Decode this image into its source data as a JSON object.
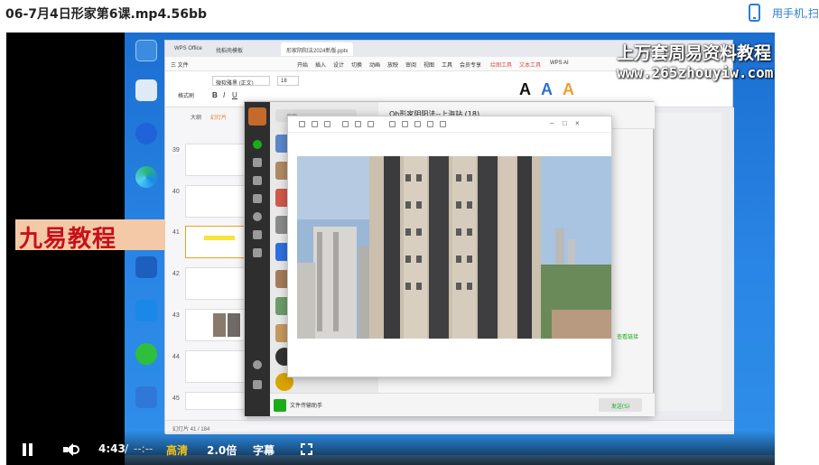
{
  "page": {
    "title": "06-7月4日形家第6课.mp4.56bb",
    "phone_link": "用手机,扫"
  },
  "wps": {
    "tabs": [
      "WPS Office",
      "找稻壳模板",
      "形家阴阳法2024新版.pptx"
    ],
    "menus": [
      "三 文件",
      "开始",
      "插入",
      "设计",
      "切换",
      "动画",
      "放映",
      "审阅",
      "视图",
      "工具",
      "会员专享",
      "绘图工具",
      "文本工具",
      "WPS AI"
    ],
    "font_name": "微软雅黑 (正文)",
    "font_size": "18",
    "format_label": "格式刷",
    "panel_tabs": [
      "大纲",
      "幻灯片"
    ],
    "slide_numbers": [
      "39",
      "40",
      "41",
      "42",
      "43",
      "44",
      "45"
    ],
    "status": "幻灯片 41 / 184",
    "notes_placeholder": "单击此处添加备注"
  },
  "wechat": {
    "search_placeholder": "搜索",
    "chat_title": "Qh形家阴阳法--上海站 (18)",
    "footer_name": "文件传输助手",
    "send_label": "发送(S)",
    "link_text": "查看链接"
  },
  "watermark": {
    "line1": "上万套周易资料教程",
    "line2": "www.265zhouyiw.com",
    "logo": "九易教程"
  },
  "player": {
    "current_time": "4:43",
    "separator": "/",
    "duration": "--:--",
    "quality": "高清",
    "speed": "2.0倍",
    "subtitle": "字幕"
  },
  "colors": {
    "accent_quality": "#f0c419",
    "desktop_blue": "#2a86e6",
    "wechat_green": "#1aad19",
    "logo_red": "#c8101a"
  }
}
